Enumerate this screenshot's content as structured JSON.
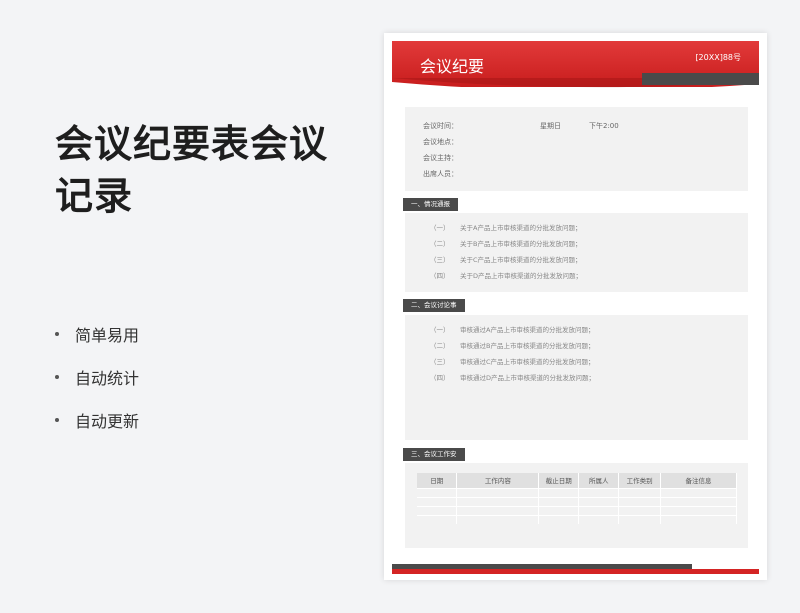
{
  "promo": {
    "headline": "会议纪要表会议记录",
    "features": [
      "简单易用",
      "自动统计",
      "自动更新"
    ]
  },
  "doc": {
    "title": "会议纪要",
    "number": "[20XX]88号",
    "info": {
      "time_label": "会议时间：",
      "weekday": "星期日",
      "time": "下午2:00",
      "place_label": "会议地点：",
      "host_label": "会议主持：",
      "attendees_label": "出席人员："
    },
    "section1": {
      "title": "一、情况通报",
      "items": [
        {
          "num": "（一）",
          "text": "关于A产品上市审核渠道的分批发放问题；"
        },
        {
          "num": "（二）",
          "text": "关于B产品上市审核渠道的分批发放问题；"
        },
        {
          "num": "（三）",
          "text": "关于C产品上市审核渠道的分批发放问题；"
        },
        {
          "num": "（四）",
          "text": "关于D产品上市审核渠道的分批发放问题；"
        }
      ]
    },
    "section2": {
      "title": "二、会议讨论事",
      "items": [
        {
          "num": "（一）",
          "text": "审核通过A产品上市审核渠道的分批发放问题；"
        },
        {
          "num": "（二）",
          "text": "审核通过B产品上市审核渠道的分批发放问题；"
        },
        {
          "num": "（三）",
          "text": "审核通过C产品上市审核渠道的分批发放问题；"
        },
        {
          "num": "（四）",
          "text": "审核通过D产品上市审核渠道的分批发放问题；"
        }
      ]
    },
    "section3": {
      "title": "三、会议工作安",
      "columns": [
        "日期",
        "工作内容",
        "截止日期",
        "所属人",
        "工作类别",
        "备注信息"
      ]
    }
  },
  "colors": {
    "brand_red": "#d42424",
    "dark_gray": "#4a4a4a",
    "panel_gray": "#f2f2f2"
  }
}
